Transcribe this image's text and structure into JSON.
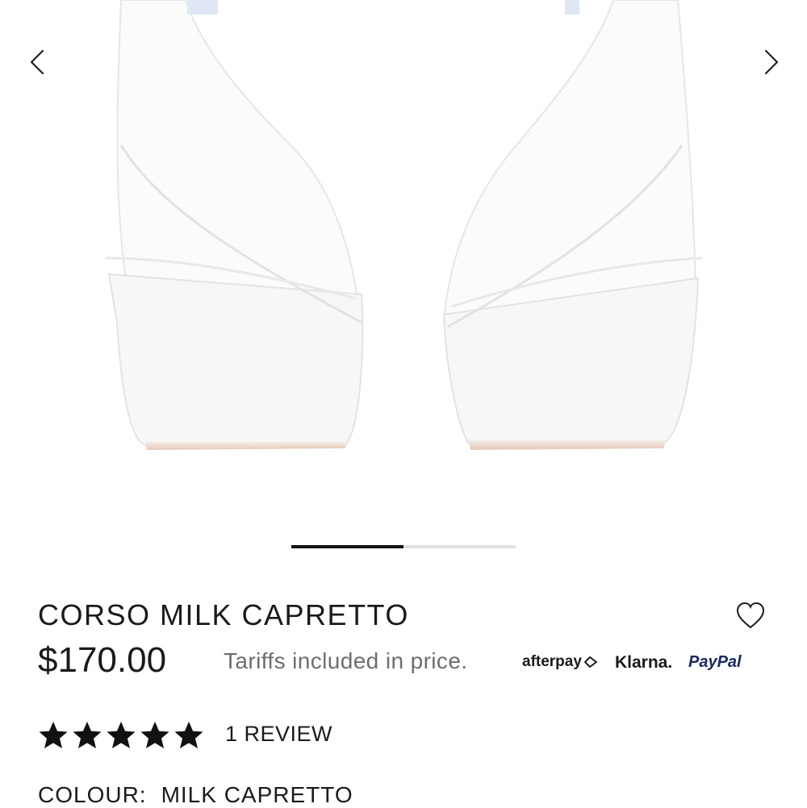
{
  "gallery": {
    "prev_icon": "chevron-left-icon",
    "next_icon": "chevron-right-icon",
    "slide_progress": 0.5
  },
  "product": {
    "name": "CORSO MILK CAPRETTO",
    "price": "$170.00",
    "tariff_note": "Tariffs included in price.",
    "wishlist_icon": "heart-icon"
  },
  "payments": {
    "afterpay": "afterpay",
    "klarna": "Klarna.",
    "paypal": "PayPal"
  },
  "rating": {
    "stars": 5,
    "max_stars": 5,
    "reviews_label": "1 REVIEW"
  },
  "colour": {
    "label": "COLOUR:",
    "value": "MILK CAPRETTO"
  },
  "colors": {
    "text": "#1a1a1a",
    "muted": "#6e6e6e",
    "paypal": "#1b2a63",
    "track": "#e2e2e2"
  }
}
